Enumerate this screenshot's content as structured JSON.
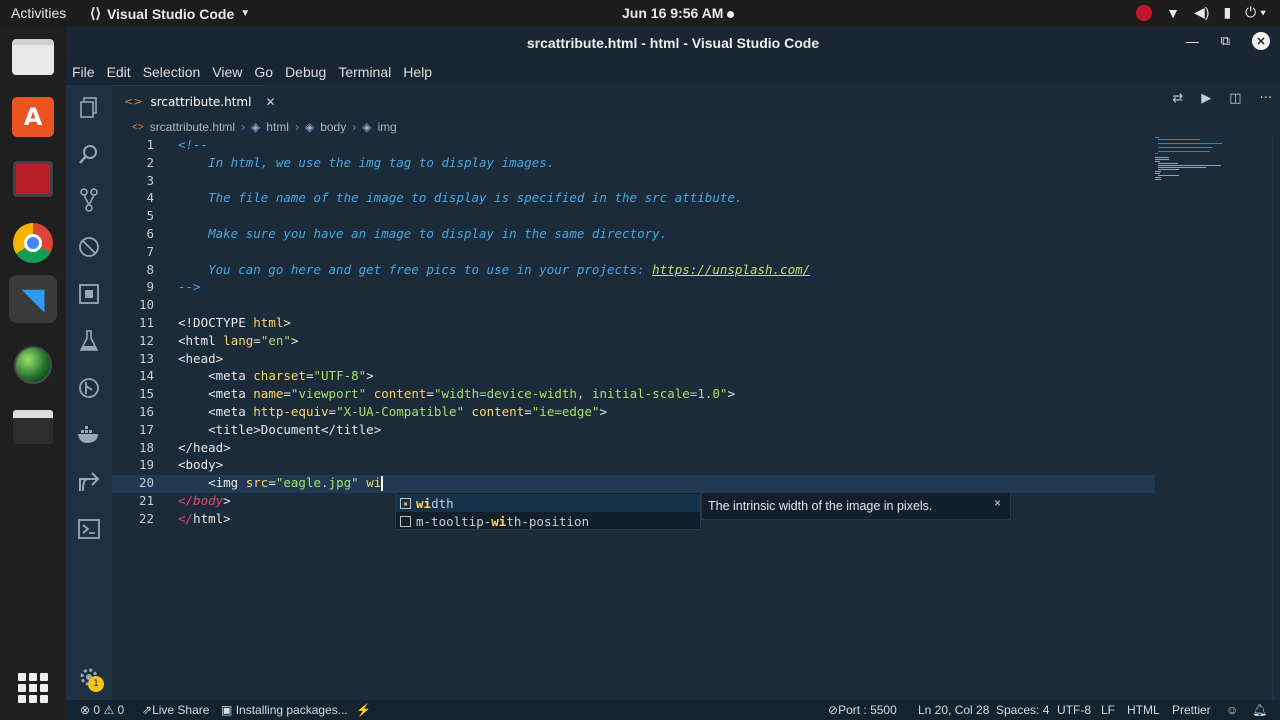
{
  "topbar": {
    "activities": "Activities",
    "app_name": "Visual Studio Code",
    "clock": "Jun 16  9:56 AM"
  },
  "window": {
    "title": "srcattribute.html - html - Visual Studio Code"
  },
  "menu": [
    "File",
    "Edit",
    "Selection",
    "View",
    "Go",
    "Debug",
    "Terminal",
    "Help"
  ],
  "tab": {
    "label": "srcattribute.html"
  },
  "breadcrumb": [
    "srcattribute.html",
    "html",
    "body",
    "img"
  ],
  "editor": {
    "current_line": 20,
    "lines": [
      "<!--",
      "    In html, we use the img tag to display images.",
      "",
      "    The file name of the image to display is specified in the src attibute.",
      "",
      "    Make sure you have an image to display in the same directory.",
      "",
      "    You can go here and get free pics to use in your projects: ",
      "-->",
      "",
      "<!DOCTYPE html>",
      "<html lang=\"en\">",
      "<head>",
      "    <meta charset=\"UTF-8\">",
      "    <meta name=\"viewport\" content=\"width=device-width, initial-scale=1.0\">",
      "    <meta http-equiv=\"X-UA-Compatible\" content=\"ie=edge\">",
      "    <title>Document</title>",
      "</head>",
      "<body>",
      "    <img src=\"eagle.jpg\" wi",
      "</body>",
      "</html>"
    ],
    "link_text": "https://unsplash.com/"
  },
  "suggest": {
    "items": [
      {
        "prefix": "wi",
        "rest": "dth"
      },
      {
        "pre": "m-tooltip-",
        "match": "wi",
        "post": "th-position"
      }
    ],
    "detail": "The intrinsic width of the image in pixels.",
    "close": "×"
  },
  "statusbar": {
    "errors": "0",
    "warnings": "0",
    "live_share": "Live Share",
    "installing": "Installing packages...",
    "port": "Port : 5500",
    "position": "Ln 20, Col 28",
    "spaces": "Spaces: 4",
    "encoding": "UTF-8",
    "eol": "LF",
    "language": "HTML",
    "formatter": "Prettier"
  },
  "notifications": {
    "badge": "1"
  },
  "colors": {
    "editor_bg": "#1b2b3a",
    "comment": "#4aa6e0",
    "attribute": "#ffd36b",
    "string": "#a5e06d"
  }
}
